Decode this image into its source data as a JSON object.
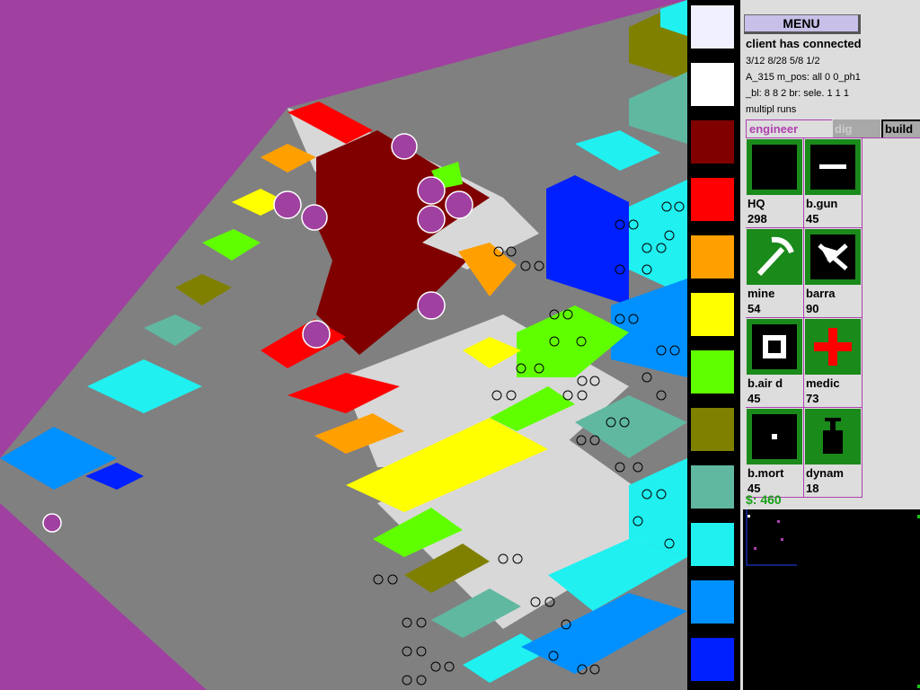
{
  "menu": {
    "label": "MENU"
  },
  "log": {
    "title": "client has connected",
    "lines": [
      "3/12 8/28 5/8 1/2",
      "A_315  m_pos: all 0 0_ph1",
      "_bl: 8 8 2 br: sele. 1 1 1",
      "multipl runs"
    ]
  },
  "tabs": {
    "engineer": "engineer",
    "dig": "dig",
    "build": "build"
  },
  "units": [
    {
      "name": "HQ",
      "cost": "298",
      "icon": "hq-icon"
    },
    {
      "name": "b.gun",
      "cost": "45",
      "icon": "gun-icon"
    },
    {
      "name": "mine",
      "cost": "54",
      "icon": "pickaxe-icon"
    },
    {
      "name": "barra",
      "cost": "90",
      "icon": "barricade-icon"
    },
    {
      "name": "b.air d",
      "cost": "45",
      "icon": "air-defense-icon"
    },
    {
      "name": "medic",
      "cost": "73",
      "icon": "medic-cross-icon"
    },
    {
      "name": "b.mort",
      "cost": "45",
      "icon": "mortar-icon"
    },
    {
      "name": "dynam",
      "cost": "18",
      "icon": "dynamite-icon"
    }
  ],
  "money": "$: 460",
  "palette": [
    "#f0f0ff",
    "#ffffff",
    "#800000",
    "#ff0000",
    "#ffa000",
    "#ffff00",
    "#60ff00",
    "#808000",
    "#60b8a0",
    "#20f0f0",
    "#0090ff",
    "#0020ff"
  ],
  "colors": {
    "background": "#a040a0",
    "panel": "#dddddd",
    "accent": "#b040b0",
    "money": "#18a018"
  }
}
